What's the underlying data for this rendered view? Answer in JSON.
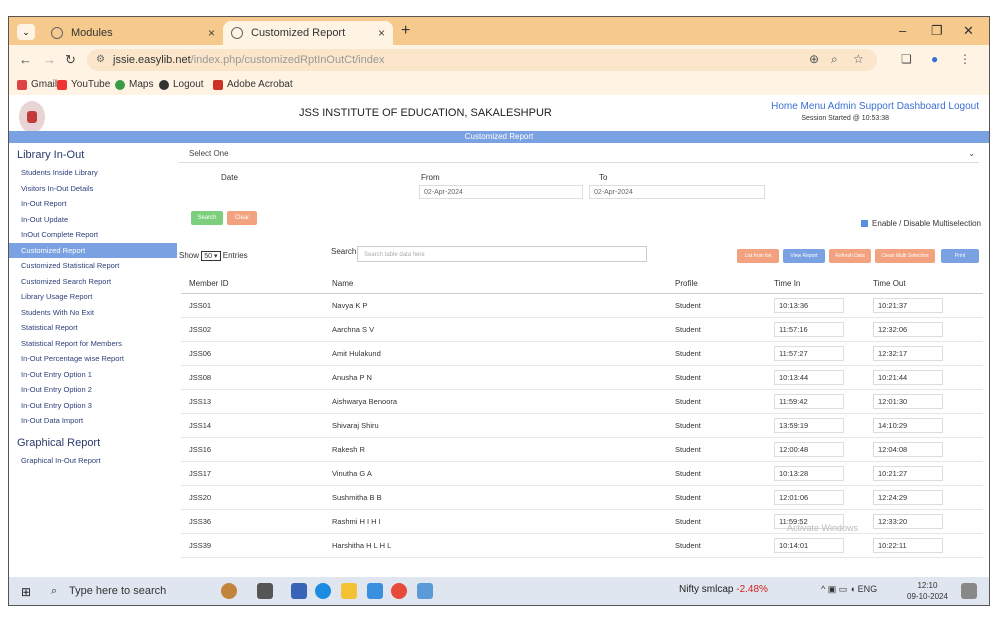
{
  "browser": {
    "tabs": [
      {
        "label": "Modules"
      },
      {
        "label": "Customized Report"
      }
    ],
    "new_tab": "+",
    "close_glyph": "×",
    "url_host": "jssie.easylib.net",
    "url_path": "/index.php/customizedRptInOutCt/index",
    "bookmarks": [
      "Gmail",
      "YouTube",
      "Maps",
      "Logout",
      "Adobe Acrobat"
    ]
  },
  "page": {
    "institution": "JSS INSTITUTE OF EDUCATION, SAKALESHPUR",
    "top_links": "Home  Menu  Admin  Support  Dashboard  Logout",
    "session": "Session Started @ 10:53:38",
    "band_title": "Customized Report"
  },
  "sidebar": {
    "heading1": "Library In-Out",
    "items": [
      "Students Inside Library",
      "Visitors In-Out Details",
      "In-Out Report",
      "In-Out Update",
      "InOut Complete Report",
      "Customized Report",
      "Customized Statistical Report",
      "Customized Search Report",
      "Library Usage Report",
      "Students With No Exit",
      "Statistical Report",
      "Statistical Report for Members",
      "In-Out Percentage wise Report",
      "In-Out Entry Option 1",
      "In-Out Entry Option 2",
      "In-Out Entry Option 3",
      "In-Out Data Import"
    ],
    "heading2": "Graphical Report",
    "items2": [
      "Graphical In-Out Report"
    ]
  },
  "form": {
    "select_one": "Select One",
    "date_label": "Date",
    "from_label": "From",
    "from_value": "02-Apr-2024",
    "to_label": "To",
    "to_value": "02-Apr-2024",
    "search_btn": "Search",
    "clear_btn": "Clear",
    "multiselect": "Enable / Disable Multiselection"
  },
  "table_controls": {
    "show": "Show",
    "entries_value": "50",
    "entries": "Entries",
    "search_label": "Search",
    "search_placeholder": "Search table data here",
    "buttons": [
      "List from list",
      "View Report",
      "Refresh Data",
      "Clean Multi Selection",
      "Print"
    ]
  },
  "table": {
    "headers": [
      "Member ID",
      "Name",
      "Profile",
      "Time In",
      "Time Out"
    ],
    "rows": [
      [
        "JSS01",
        "Navya K P",
        "Student",
        "10:13:36",
        "10:21:37"
      ],
      [
        "JSS02",
        "Aarchna S V",
        "Student",
        "11:57:16",
        "12:32:06"
      ],
      [
        "JSS06",
        "Amit Hulakund",
        "Student",
        "11:57:27",
        "12:32:17"
      ],
      [
        "JSS08",
        "Anusha P N",
        "Student",
        "10:13:44",
        "10:21:44"
      ],
      [
        "JSS13",
        "Aishwarya Benoora",
        "Student",
        "11:59:42",
        "12:01:30"
      ],
      [
        "JSS14",
        "Shivaraj Shiru",
        "Student",
        "13:59:19",
        "14:10:29"
      ],
      [
        "JSS16",
        "Rakesh R",
        "Student",
        "12:00:48",
        "12:04:08"
      ],
      [
        "JSS17",
        "Vinutha G A",
        "Student",
        "10:13:28",
        "10:21:27"
      ],
      [
        "JSS20",
        "Sushmitha B B",
        "Student",
        "12:01:06",
        "12:24:29"
      ],
      [
        "JSS36",
        "Rashmi H I H I",
        "Student",
        "11:59:52",
        "12:33:20"
      ],
      [
        "JSS39",
        "Harshitha H L H L",
        "Student",
        "10:14:01",
        "10:22:11"
      ]
    ]
  },
  "watermark": "Activate Windows",
  "taskbar": {
    "search": "Type here to search",
    "stock_label": "Nifty smlcap",
    "stock_change": "-2.48%",
    "lang": "ENG",
    "time": "12:10",
    "date": "09-10-2024"
  },
  "colors": {
    "tabbar": "#f6c98c",
    "band": "#7aa1e2",
    "search_btn": "#7dcf7d",
    "clear_btn": "#f2a27e",
    "export_orange": "#f2a27e",
    "export_blue": "#7aa1e2"
  }
}
